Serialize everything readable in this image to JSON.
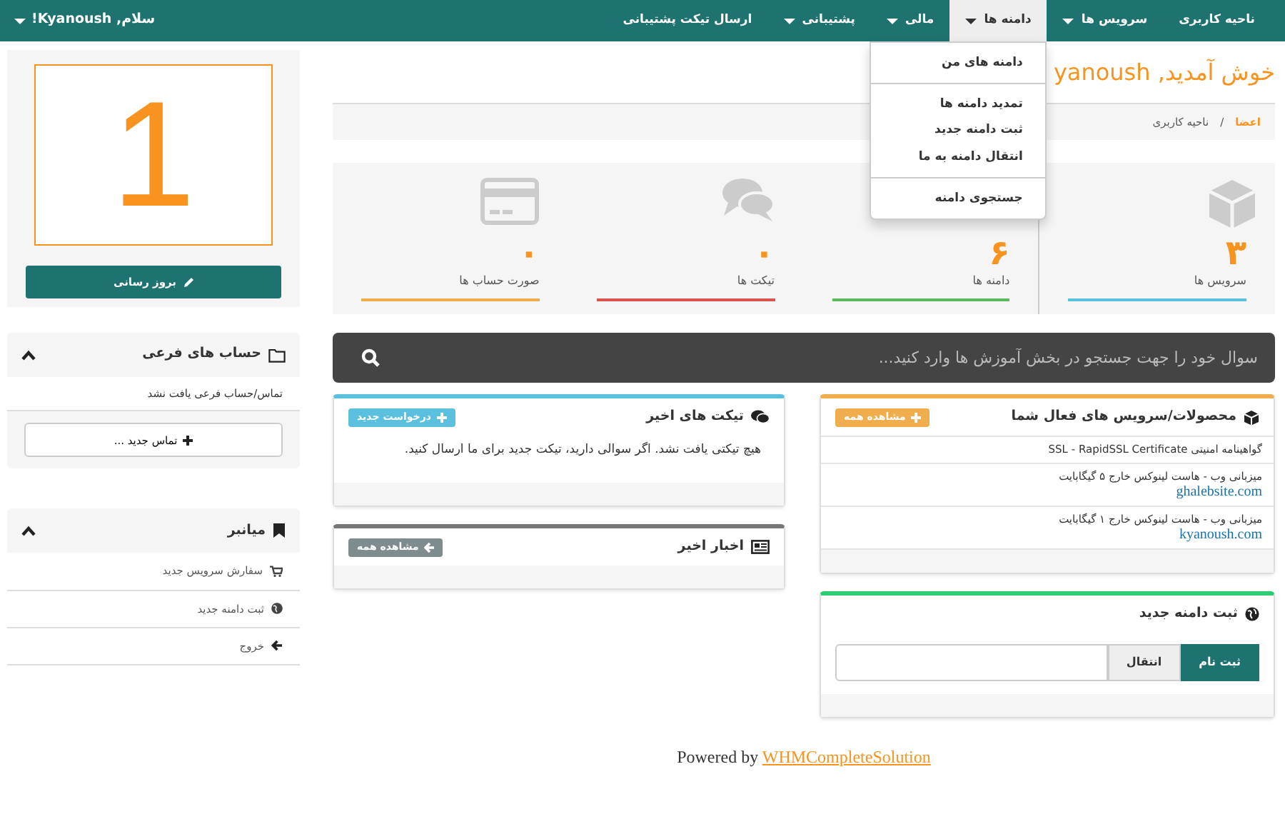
{
  "navbar": {
    "items": [
      {
        "label": "ناحیه کاربری",
        "dropdown": false,
        "selected": false
      },
      {
        "label": "سرویس ها",
        "dropdown": true,
        "selected": false
      },
      {
        "label": "دامنه ها",
        "dropdown": true,
        "selected": true
      },
      {
        "label": "مالی",
        "dropdown": true,
        "selected": false
      },
      {
        "label": "پشتیبانی",
        "dropdown": true,
        "selected": false
      },
      {
        "label": "ارسال تیکت پشتیبانی",
        "dropdown": false,
        "selected": false
      }
    ],
    "greeting": "سلام, Kyanoush!"
  },
  "open_menu": {
    "groups": [
      [
        "دامنه های من"
      ],
      [
        "تمدید دامنه ها",
        "ثبت دامنه جدید",
        "انتقال دامنه به ما"
      ],
      [
        "جستجوی دامنه"
      ]
    ]
  },
  "welcome_title": "خوش آمدید, yanoush",
  "breadcrumb": {
    "items": [
      "اعضا",
      "ناحیه کاربری"
    ],
    "separator": "/"
  },
  "stats": [
    {
      "value": "۳",
      "label": "سرویس ها",
      "color": "#5bc0de"
    },
    {
      "value": "۶",
      "label": "دامنه ها",
      "color": "#5cb85c"
    },
    {
      "value": "۰",
      "label": "تیکت ها",
      "color": "#d9534f"
    },
    {
      "value": "۰",
      "label": "صورت حساب ها",
      "color": "#f0ad4e"
    }
  ],
  "search": {
    "placeholder": "سوال خود را جهت جستجو در بخش آموزش ها وارد کنید..."
  },
  "products_panel": {
    "title": "محصولات/سرویس های فعال شما",
    "button": "مشاهده همه",
    "items": [
      {
        "name": "گواهینامه امنیتی SSL - RapidSSL Certificate"
      },
      {
        "name": "میزبانی وب - هاست لینوکس خارج ۵ گیگابایت",
        "domain": "ghalebsite.com"
      },
      {
        "name": "میزبانی وب - هاست لینوکس خارج ۱ گیگابایت",
        "domain": "kyanoush.com"
      }
    ]
  },
  "tickets_panel": {
    "title": "تیکت های اخیر",
    "button": "درخواست جدید",
    "message": "هیچ تیکتی یافت نشد. اگر سوالی دارید، تیکت جدید برای ما ارسال کنید."
  },
  "news_panel": {
    "title": "اخبار اخیر",
    "button": "مشاهده همه"
  },
  "domain_panel": {
    "title": "ثبت دامنه جدید",
    "buttons": [
      {
        "label": "ثبت نام",
        "selected": true
      },
      {
        "label": "انتقال",
        "selected": false
      }
    ]
  },
  "sidebar": {
    "big_number": "1",
    "update_button": "بروز رسانی",
    "subaccounts": {
      "title": "حساب های فرعی",
      "expanded": true,
      "message": "تماس/حساب فرعی یافت نشد",
      "button": "تماس جدید ..."
    },
    "shortcuts": {
      "title": "میانبر",
      "expanded": true,
      "items": [
        "سفارش سرویس جدید",
        "ثبت دامنه جدید",
        "خروج"
      ]
    }
  },
  "footer": {
    "text": "Powered by",
    "link": "WHMCompleteSolution"
  }
}
